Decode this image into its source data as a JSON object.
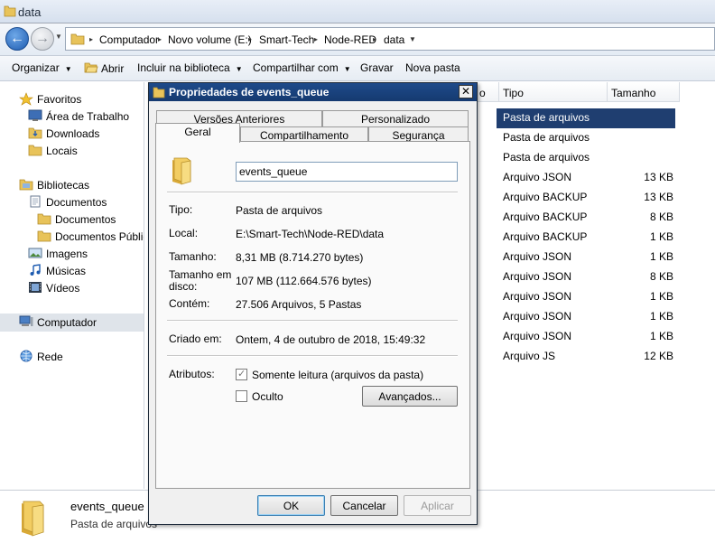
{
  "window": {
    "title": "data"
  },
  "breadcrumbs": [
    "Computador",
    "Novo volume (E:)",
    "Smart-Tech",
    "Node-RED",
    "data"
  ],
  "toolbar": {
    "organize": "Organizar",
    "open": "Abrir",
    "include_library": "Incluir na biblioteca",
    "share": "Compartilhar com",
    "burn": "Gravar",
    "new_folder": "Nova pasta"
  },
  "nav": {
    "favorites": "Favoritos",
    "desktop": "Área de Trabalho",
    "downloads": "Downloads",
    "places": "Locais",
    "libraries": "Bibliotecas",
    "documents": "Documentos",
    "my_documents": "Documentos",
    "public_documents": "Documentos Públicos",
    "images": "Imagens",
    "music": "Músicas",
    "videos": "Vídeos",
    "computer": "Computador",
    "network": "Rede"
  },
  "columns": {
    "name_fragment": "o",
    "type": "Tipo",
    "size": "Tamanho"
  },
  "files": [
    {
      "type": "Pasta de arquivos",
      "size": ""
    },
    {
      "type": "Pasta de arquivos",
      "size": ""
    },
    {
      "type": "Pasta de arquivos",
      "size": ""
    },
    {
      "type": "Arquivo JSON",
      "size": "13 KB"
    },
    {
      "type": "Arquivo BACKUP",
      "size": "13 KB"
    },
    {
      "type": "Arquivo BACKUP",
      "size": "8 KB"
    },
    {
      "type": "Arquivo BACKUP",
      "size": "1 KB"
    },
    {
      "type": "Arquivo JSON",
      "size": "1 KB"
    },
    {
      "type": "Arquivo JSON",
      "size": "8 KB"
    },
    {
      "type": "Arquivo JSON",
      "size": "1 KB"
    },
    {
      "type": "Arquivo JSON",
      "size": "1 KB"
    },
    {
      "type": "Arquivo JSON",
      "size": "1 KB"
    },
    {
      "type": "Arquivo JS",
      "size": "12 KB"
    }
  ],
  "details": {
    "name": "events_queue",
    "type": "Pasta de arquivos"
  },
  "dialog": {
    "title": "Propriedades de events_queue",
    "close": "✕",
    "tabs": {
      "previous_versions": "Versões Anteriores",
      "customize": "Personalizado",
      "general": "Geral",
      "sharing": "Compartilhamento",
      "security": "Segurança"
    },
    "folder_name": "events_queue",
    "props": {
      "type_label": "Tipo:",
      "type_value": "Pasta de arquivos",
      "location_label": "Local:",
      "location_value": "E:\\Smart-Tech\\Node-RED\\data",
      "size_label": "Tamanho:",
      "size_value": "8,31 MB (8.714.270 bytes)",
      "disk_size_label_1": "Tamanho em",
      "disk_size_label_2": "disco:",
      "disk_size_value": "107 MB (112.664.576 bytes)",
      "contains_label": "Contém:",
      "contains_value": "27.506 Arquivos, 5 Pastas",
      "created_label": "Criado em:",
      "created_value": "Ontem, 4 de outubro de 2018, 15:49:32",
      "attributes_label": "Atributos:",
      "readonly_label": "Somente leitura (arquivos da pasta)",
      "hidden_label": "Oculto",
      "advanced_button": "Avançados..."
    },
    "buttons": {
      "ok": "OK",
      "cancel": "Cancelar",
      "apply": "Aplicar"
    }
  }
}
